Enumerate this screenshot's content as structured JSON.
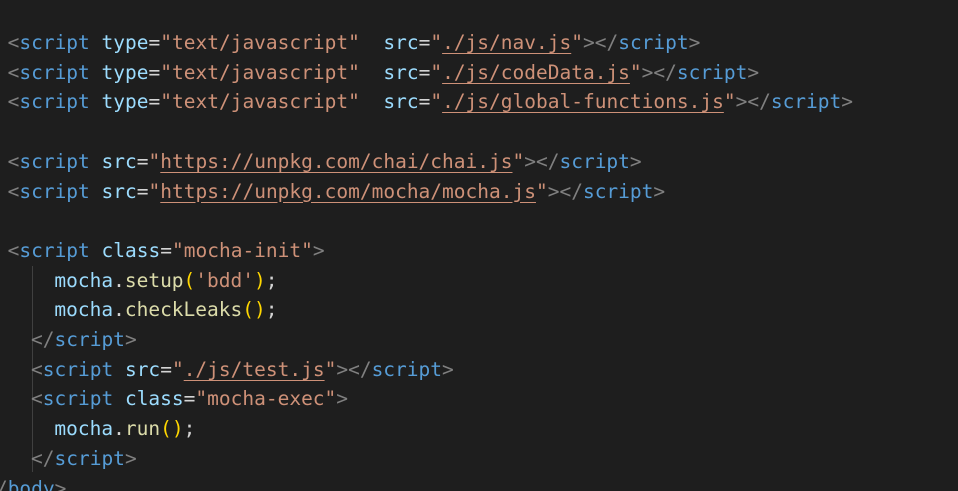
{
  "editor": {
    "language": "html",
    "theme": "dark",
    "colors": {
      "background": "#1e1e1e",
      "tag": "#569cd6",
      "tag_bracket": "#808080",
      "attribute": "#9cdcfe",
      "string": "#ce9178",
      "function": "#dcdcaa",
      "bracket": "#ffd700",
      "text": "#d4d4d4"
    },
    "lines": [
      {
        "indent": 1,
        "tokens": [
          [
            "<",
            "punct"
          ],
          [
            "script",
            "tag"
          ],
          [
            " ",
            "plain"
          ],
          [
            "type",
            "attr"
          ],
          [
            "=",
            "plain"
          ],
          [
            "\"text/javascript\"",
            "str"
          ],
          [
            "  ",
            "plain"
          ],
          [
            "src",
            "attr"
          ],
          [
            "=",
            "plain"
          ],
          [
            "\"",
            "str"
          ],
          [
            "./js/nav.js",
            "link"
          ],
          [
            "\"",
            "str"
          ],
          [
            ">",
            "punct"
          ],
          [
            "</",
            "punct"
          ],
          [
            "script",
            "tag"
          ],
          [
            ">",
            "punct"
          ]
        ]
      },
      {
        "indent": 1,
        "tokens": [
          [
            "<",
            "punct"
          ],
          [
            "script",
            "tag"
          ],
          [
            " ",
            "plain"
          ],
          [
            "type",
            "attr"
          ],
          [
            "=",
            "plain"
          ],
          [
            "\"text/javascript\"",
            "str"
          ],
          [
            "  ",
            "plain"
          ],
          [
            "src",
            "attr"
          ],
          [
            "=",
            "plain"
          ],
          [
            "\"",
            "str"
          ],
          [
            "./js/codeData.js",
            "link"
          ],
          [
            "\"",
            "str"
          ],
          [
            ">",
            "punct"
          ],
          [
            "</",
            "punct"
          ],
          [
            "script",
            "tag"
          ],
          [
            ">",
            "punct"
          ]
        ]
      },
      {
        "indent": 1,
        "tokens": [
          [
            "<",
            "punct"
          ],
          [
            "script",
            "tag"
          ],
          [
            " ",
            "plain"
          ],
          [
            "type",
            "attr"
          ],
          [
            "=",
            "plain"
          ],
          [
            "\"text/javascript\"",
            "str"
          ],
          [
            "  ",
            "plain"
          ],
          [
            "src",
            "attr"
          ],
          [
            "=",
            "plain"
          ],
          [
            "\"",
            "str"
          ],
          [
            "./js/global-functions.js",
            "link"
          ],
          [
            "\"",
            "str"
          ],
          [
            ">",
            "punct"
          ],
          [
            "</",
            "punct"
          ],
          [
            "script",
            "tag"
          ],
          [
            ">",
            "punct"
          ]
        ]
      },
      {
        "indent": 1,
        "tokens": []
      },
      {
        "indent": 1,
        "tokens": [
          [
            "<",
            "punct"
          ],
          [
            "script",
            "tag"
          ],
          [
            " ",
            "plain"
          ],
          [
            "src",
            "attr"
          ],
          [
            "=",
            "plain"
          ],
          [
            "\"",
            "str"
          ],
          [
            "https://unpkg.com/chai/chai.js",
            "link"
          ],
          [
            "\"",
            "str"
          ],
          [
            ">",
            "punct"
          ],
          [
            "</",
            "punct"
          ],
          [
            "script",
            "tag"
          ],
          [
            ">",
            "punct"
          ]
        ]
      },
      {
        "indent": 1,
        "tokens": [
          [
            "<",
            "punct"
          ],
          [
            "script",
            "tag"
          ],
          [
            " ",
            "plain"
          ],
          [
            "src",
            "attr"
          ],
          [
            "=",
            "plain"
          ],
          [
            "\"",
            "str"
          ],
          [
            "https://unpkg.com/mocha/mocha.js",
            "link"
          ],
          [
            "\"",
            "str"
          ],
          [
            ">",
            "punct"
          ],
          [
            "</",
            "punct"
          ],
          [
            "script",
            "tag"
          ],
          [
            ">",
            "punct"
          ]
        ]
      },
      {
        "indent": 1,
        "tokens": []
      },
      {
        "indent": 1,
        "tokens": [
          [
            "<",
            "punct"
          ],
          [
            "script",
            "tag"
          ],
          [
            " ",
            "plain"
          ],
          [
            "class",
            "attr"
          ],
          [
            "=",
            "plain"
          ],
          [
            "\"mocha-init\"",
            "str"
          ],
          [
            ">",
            "punct"
          ]
        ]
      },
      {
        "indent": 3,
        "tokens": [
          [
            "mocha",
            "var"
          ],
          [
            ".",
            "plain"
          ],
          [
            "setup",
            "func"
          ],
          [
            "(",
            "brace"
          ],
          [
            "'bdd'",
            "str"
          ],
          [
            ")",
            "brace"
          ],
          [
            ";",
            "plain"
          ]
        ]
      },
      {
        "indent": 3,
        "tokens": [
          [
            "mocha",
            "var"
          ],
          [
            ".",
            "plain"
          ],
          [
            "checkLeaks",
            "func"
          ],
          [
            "()",
            "brace"
          ],
          [
            ";",
            "plain"
          ]
        ]
      },
      {
        "indent": 2,
        "tokens": [
          [
            "</",
            "punct"
          ],
          [
            "script",
            "tag"
          ],
          [
            ">",
            "punct"
          ]
        ]
      },
      {
        "indent": 2,
        "tokens": [
          [
            "<",
            "punct"
          ],
          [
            "script",
            "tag"
          ],
          [
            " ",
            "plain"
          ],
          [
            "src",
            "attr"
          ],
          [
            "=",
            "plain"
          ],
          [
            "\"",
            "str"
          ],
          [
            "./js/test.js",
            "link"
          ],
          [
            "\"",
            "str"
          ],
          [
            ">",
            "punct"
          ],
          [
            "</",
            "punct"
          ],
          [
            "script",
            "tag"
          ],
          [
            ">",
            "punct"
          ]
        ]
      },
      {
        "indent": 2,
        "tokens": [
          [
            "<",
            "punct"
          ],
          [
            "script",
            "tag"
          ],
          [
            " ",
            "plain"
          ],
          [
            "class",
            "attr"
          ],
          [
            "=",
            "plain"
          ],
          [
            "\"mocha-exec\"",
            "str"
          ],
          [
            ">",
            "punct"
          ]
        ]
      },
      {
        "indent": 3,
        "tokens": [
          [
            "mocha",
            "var"
          ],
          [
            ".",
            "plain"
          ],
          [
            "run",
            "func"
          ],
          [
            "()",
            "brace"
          ],
          [
            ";",
            "plain"
          ]
        ]
      },
      {
        "indent": 2,
        "tokens": [
          [
            "</",
            "punct"
          ],
          [
            "script",
            "tag"
          ],
          [
            ">",
            "punct"
          ]
        ]
      },
      {
        "indent": 0,
        "tokens": [
          [
            "</",
            "punct"
          ],
          [
            "body",
            "tag"
          ],
          [
            ">",
            "punct"
          ]
        ]
      }
    ]
  }
}
